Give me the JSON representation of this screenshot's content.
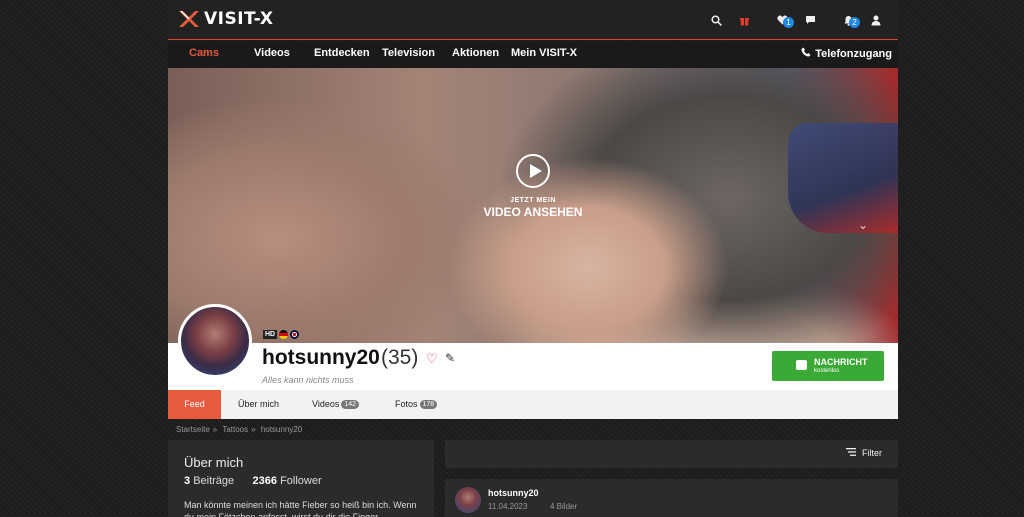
{
  "brand": {
    "name": "VISIT-X",
    "accent": "#e85a3d"
  },
  "topbar": {
    "icons": [
      "search-icon",
      "gift-icon",
      "heart-icon",
      "chat-icon",
      "bell-icon",
      "user-icon"
    ],
    "favorites_badge": "1",
    "notifications_badge": "2"
  },
  "nav": {
    "items": [
      "Cams",
      "Videos",
      "Entdecken",
      "Television",
      "Aktionen",
      "Mein VISIT-X"
    ],
    "phone": "Telefonzugang"
  },
  "hero": {
    "cta_small": "JETZT MEIN",
    "cta_big": "VIDEO ANSEHEN"
  },
  "profile": {
    "badge_hd": "HD",
    "username": "hotsunny20",
    "age": "(35)",
    "motto": "Alles kann nichts muss",
    "message_label": "NACHRICHT",
    "message_sub": "kostenlos",
    "message_color": "#3aa935"
  },
  "tabs": [
    {
      "label": "Feed",
      "count": ""
    },
    {
      "label": "Über mich",
      "count": ""
    },
    {
      "label": "Videos",
      "count": "142"
    },
    {
      "label": "Fotos",
      "count": "178"
    }
  ],
  "breadcrumb": [
    "Startseite",
    "Tattoos",
    "hotsunny20"
  ],
  "about": {
    "title": "Über mich",
    "posts_count": "3",
    "posts_label": "Beiträge",
    "followers_count": "2366",
    "followers_label": "Follower",
    "bio": "Man könnte meinen ich hätte Fieber so heiß bin ich. Wenn du mein Fötzchen anfasst, wirst du dir die Finger"
  },
  "feed": {
    "filter_label": "Filter",
    "post": {
      "author": "hotsunny20",
      "date": "11.04.2023",
      "count": "4 Bilder"
    }
  }
}
